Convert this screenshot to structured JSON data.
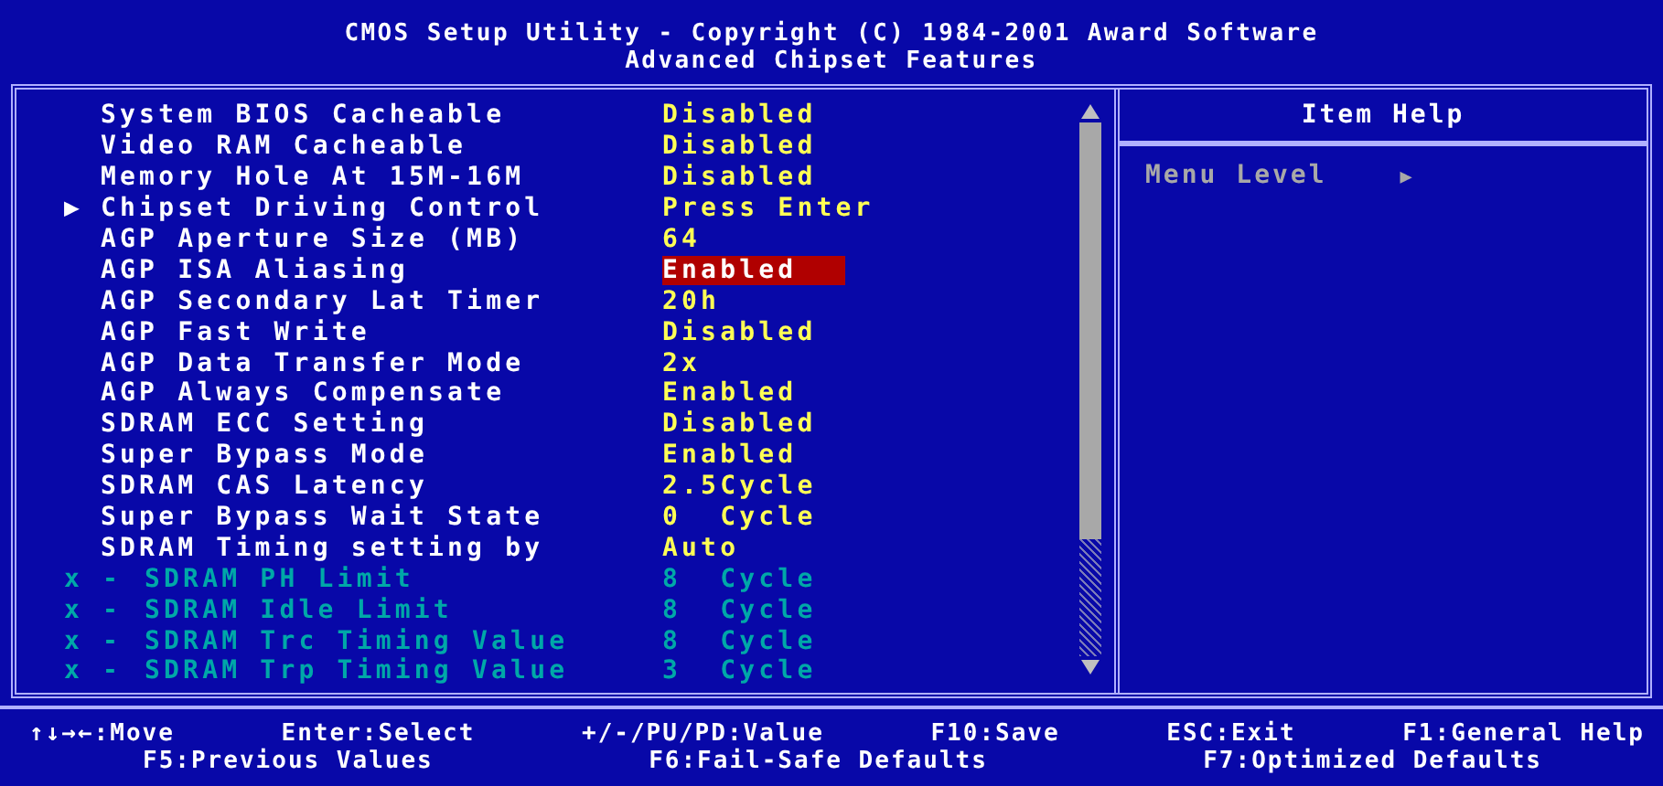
{
  "title": {
    "line1": "CMOS Setup Utility - Copyright (C) 1984-2001 Award Software",
    "line2": "Advanced Chipset Features"
  },
  "items": [
    {
      "kind": "option",
      "label": "System BIOS Cacheable",
      "value": "Disabled",
      "selected": false
    },
    {
      "kind": "option",
      "label": "Video RAM Cacheable",
      "value": "Disabled",
      "selected": false
    },
    {
      "kind": "option",
      "label": "Memory Hole At 15M-16M",
      "value": "Disabled",
      "selected": false
    },
    {
      "kind": "submenu",
      "marker": "▶",
      "label": "Chipset Driving Control",
      "value": "Press Enter",
      "selected": false
    },
    {
      "kind": "option",
      "label": "AGP Aperture Size (MB)",
      "value": "64",
      "selected": false
    },
    {
      "kind": "option",
      "label": "AGP ISA Aliasing",
      "value": "Enabled",
      "selected": true
    },
    {
      "kind": "option",
      "label": "AGP Secondary Lat Timer",
      "value": "20h",
      "selected": false
    },
    {
      "kind": "option",
      "label": "AGP Fast Write",
      "value": "Disabled",
      "selected": false
    },
    {
      "kind": "option",
      "label": "AGP Data Transfer Mode",
      "value": "2x",
      "selected": false
    },
    {
      "kind": "option",
      "label": "AGP Always Compensate",
      "value": "Enabled",
      "selected": false
    },
    {
      "kind": "option",
      "label": "SDRAM ECC Setting",
      "value": "Disabled",
      "selected": false
    },
    {
      "kind": "option",
      "label": "Super Bypass Mode",
      "value": "Enabled",
      "selected": false
    },
    {
      "kind": "option",
      "label": "SDRAM CAS Latency",
      "value": "2.5Cycle",
      "selected": false
    },
    {
      "kind": "option",
      "label": "Super Bypass Wait State",
      "value": "0  Cycle",
      "selected": false
    },
    {
      "kind": "option",
      "label": "SDRAM Timing setting by",
      "value": "Auto",
      "selected": false
    },
    {
      "kind": "locked",
      "marker": "x -",
      "label": "SDRAM PH Limit",
      "value": "8  Cycle",
      "selected": false
    },
    {
      "kind": "locked",
      "marker": "x -",
      "label": "SDRAM Idle Limit",
      "value": "8  Cycle",
      "selected": false
    },
    {
      "kind": "locked",
      "marker": "x -",
      "label": "SDRAM Trc Timing Value",
      "value": "8  Cycle",
      "selected": false
    },
    {
      "kind": "locked",
      "marker": "x -",
      "label": "SDRAM Trp Timing Value",
      "value": "3  Cycle",
      "selected": false
    }
  ],
  "help": {
    "title": "Item Help",
    "label": "Menu Level",
    "marker": "▶"
  },
  "footer": [
    [
      "↑↓→←:Move",
      "Enter:Select",
      "+/-/PU/PD:Value",
      "F10:Save",
      "ESC:Exit",
      "F1:General Help"
    ],
    [
      "F5:Previous Values",
      "F6:Fail-Safe Defaults",
      "F7:Optimized Defaults"
    ]
  ]
}
